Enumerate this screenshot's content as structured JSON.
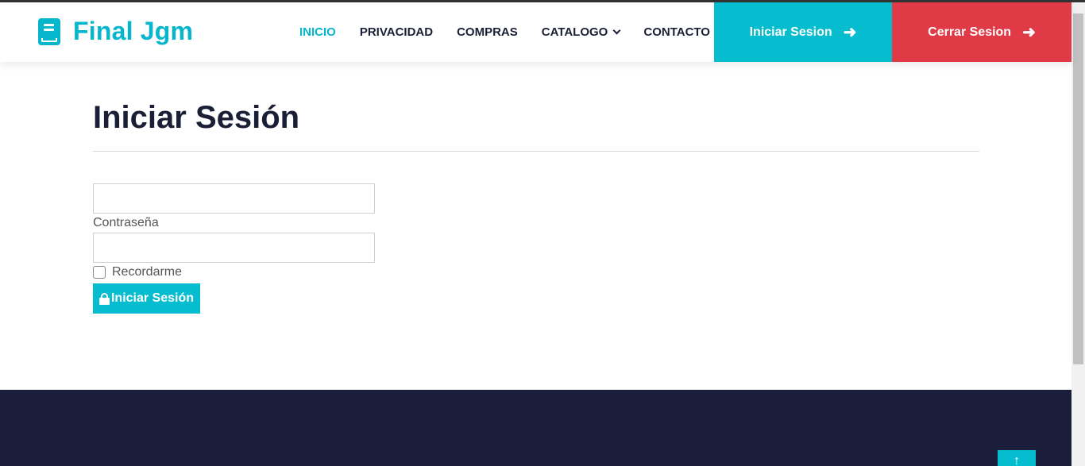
{
  "brand": {
    "name": "Final Jgm",
    "icon": "book-icon"
  },
  "nav": {
    "items": [
      {
        "label": "INICIO",
        "active": true
      },
      {
        "label": "PRIVACIDAD"
      },
      {
        "label": "COMPRAS"
      },
      {
        "label": "CATALOGO",
        "dropdown": true
      },
      {
        "label": "CONTACTO"
      }
    ]
  },
  "header_buttons": {
    "login": {
      "label": "Iniciar Sesion",
      "icon": "arrow-right-icon",
      "color": "#06bccf"
    },
    "logout": {
      "label": "Cerrar Sesion",
      "icon": "arrow-right-icon",
      "color": "#e03a47"
    }
  },
  "login_form": {
    "title": "Iniciar Sesión",
    "username_value": "",
    "password_label": "Contraseña",
    "password_value": "",
    "remember_label": "Recordarme",
    "remember_checked": false,
    "submit_label": "Iniciar Sesión",
    "submit_icon": "lock-icon"
  },
  "back_to_top": {
    "icon": "arrow-up-icon",
    "glyph": "↑"
  },
  "colors": {
    "accent": "#06bccf",
    "danger": "#e03a47",
    "footer": "#1a1e3a",
    "heading": "#1a1f36"
  }
}
